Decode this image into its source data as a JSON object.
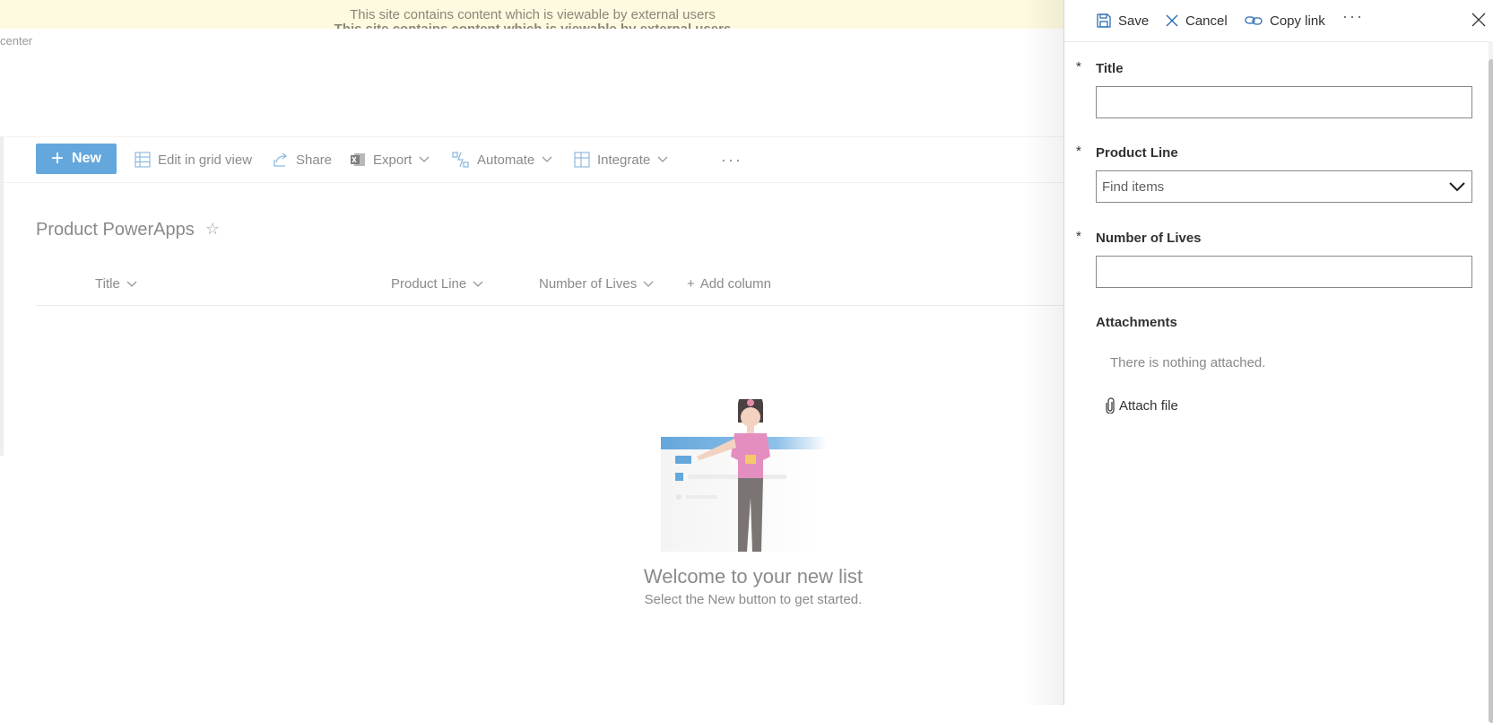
{
  "banner": {
    "message": "This site contains content which is viewable by external users",
    "message_echo": "This site contains content which is viewable by external users"
  },
  "breadcrumb": {
    "fragment": "center"
  },
  "commandbar": {
    "new_label": "New",
    "edit_grid_label": "Edit in grid view",
    "share_label": "Share",
    "export_label": "Export",
    "automate_label": "Automate",
    "integrate_label": "Integrate",
    "more_label": "···"
  },
  "list": {
    "title": "Product PowerApps",
    "columns": [
      "Title",
      "Product Line",
      "Number of Lives"
    ],
    "add_column_label": "Add column"
  },
  "empty_state": {
    "heading": "Welcome to your new list",
    "subtext": "Select the New button to get started."
  },
  "panel": {
    "save_label": "Save",
    "cancel_label": "Cancel",
    "copy_link_label": "Copy link",
    "more_label": "···",
    "required_mark": "*",
    "fields": {
      "title_label": "Title",
      "title_value": "",
      "product_line_label": "Product Line",
      "product_line_placeholder": "Find items",
      "lives_label": "Number of Lives",
      "lives_value": ""
    },
    "attachments_label": "Attachments",
    "attachments_empty": "There is nothing attached.",
    "attach_file_label": "Attach file"
  },
  "colors": {
    "accent": "#64a7dc",
    "banner": "#fefadf",
    "panel_text": "#323130",
    "dim_text": "#8b8a89"
  }
}
